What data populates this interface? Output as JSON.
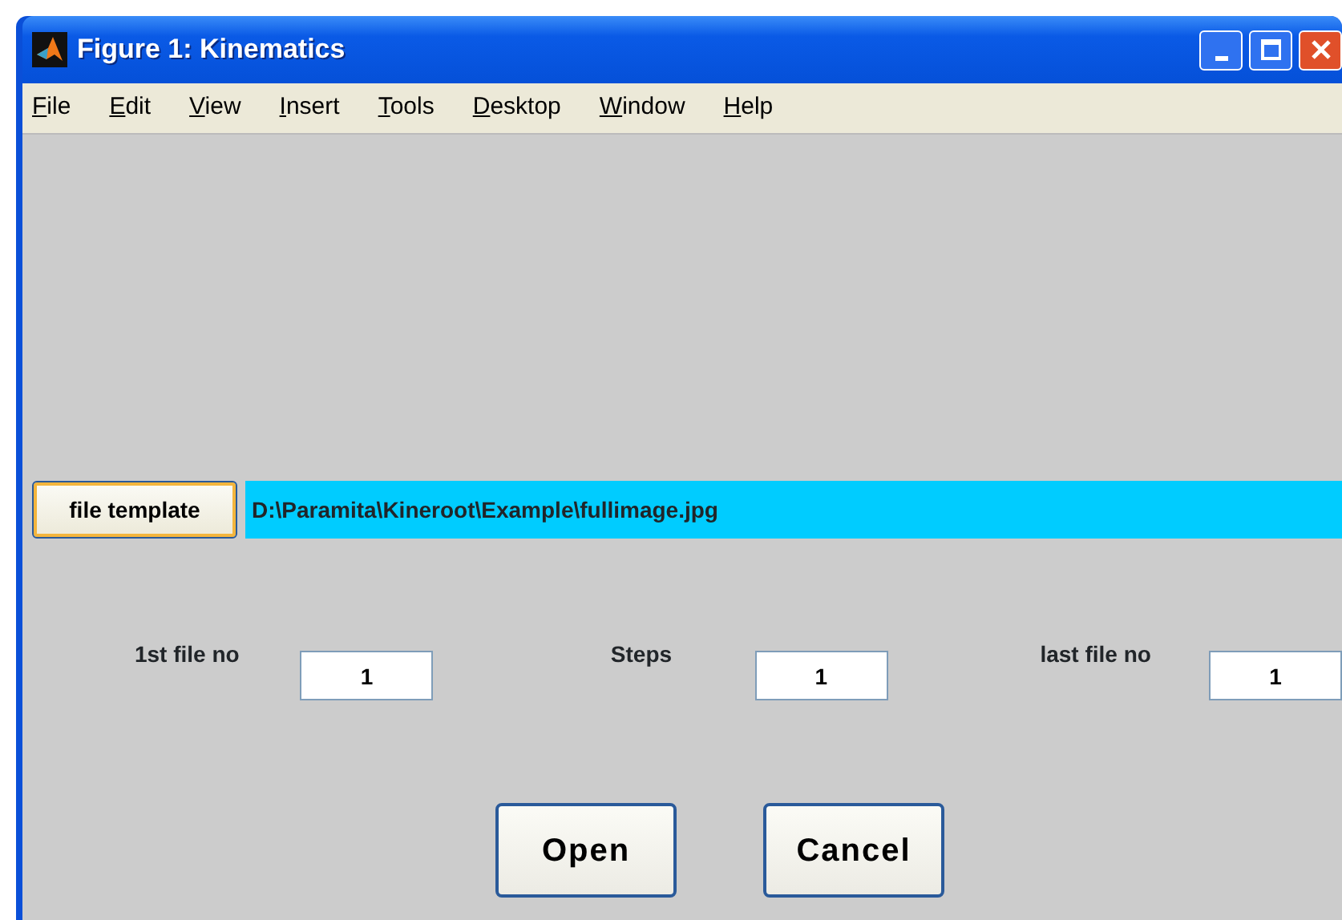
{
  "window": {
    "title": "Figure 1: Kinematics"
  },
  "menu": [
    "File",
    "Edit",
    "View",
    "Insert",
    "Tools",
    "Desktop",
    "Window",
    "Help"
  ],
  "template": {
    "button": "file template",
    "path": "D:\\Paramita\\Kineroot\\Example\\fullimage.jpg"
  },
  "fields": [
    {
      "label": "1st file no",
      "value": "1"
    },
    {
      "label": "Steps",
      "value": "1"
    },
    {
      "label": "last file no",
      "value": "1"
    }
  ],
  "buttons": [
    "Open",
    "Cancel"
  ]
}
